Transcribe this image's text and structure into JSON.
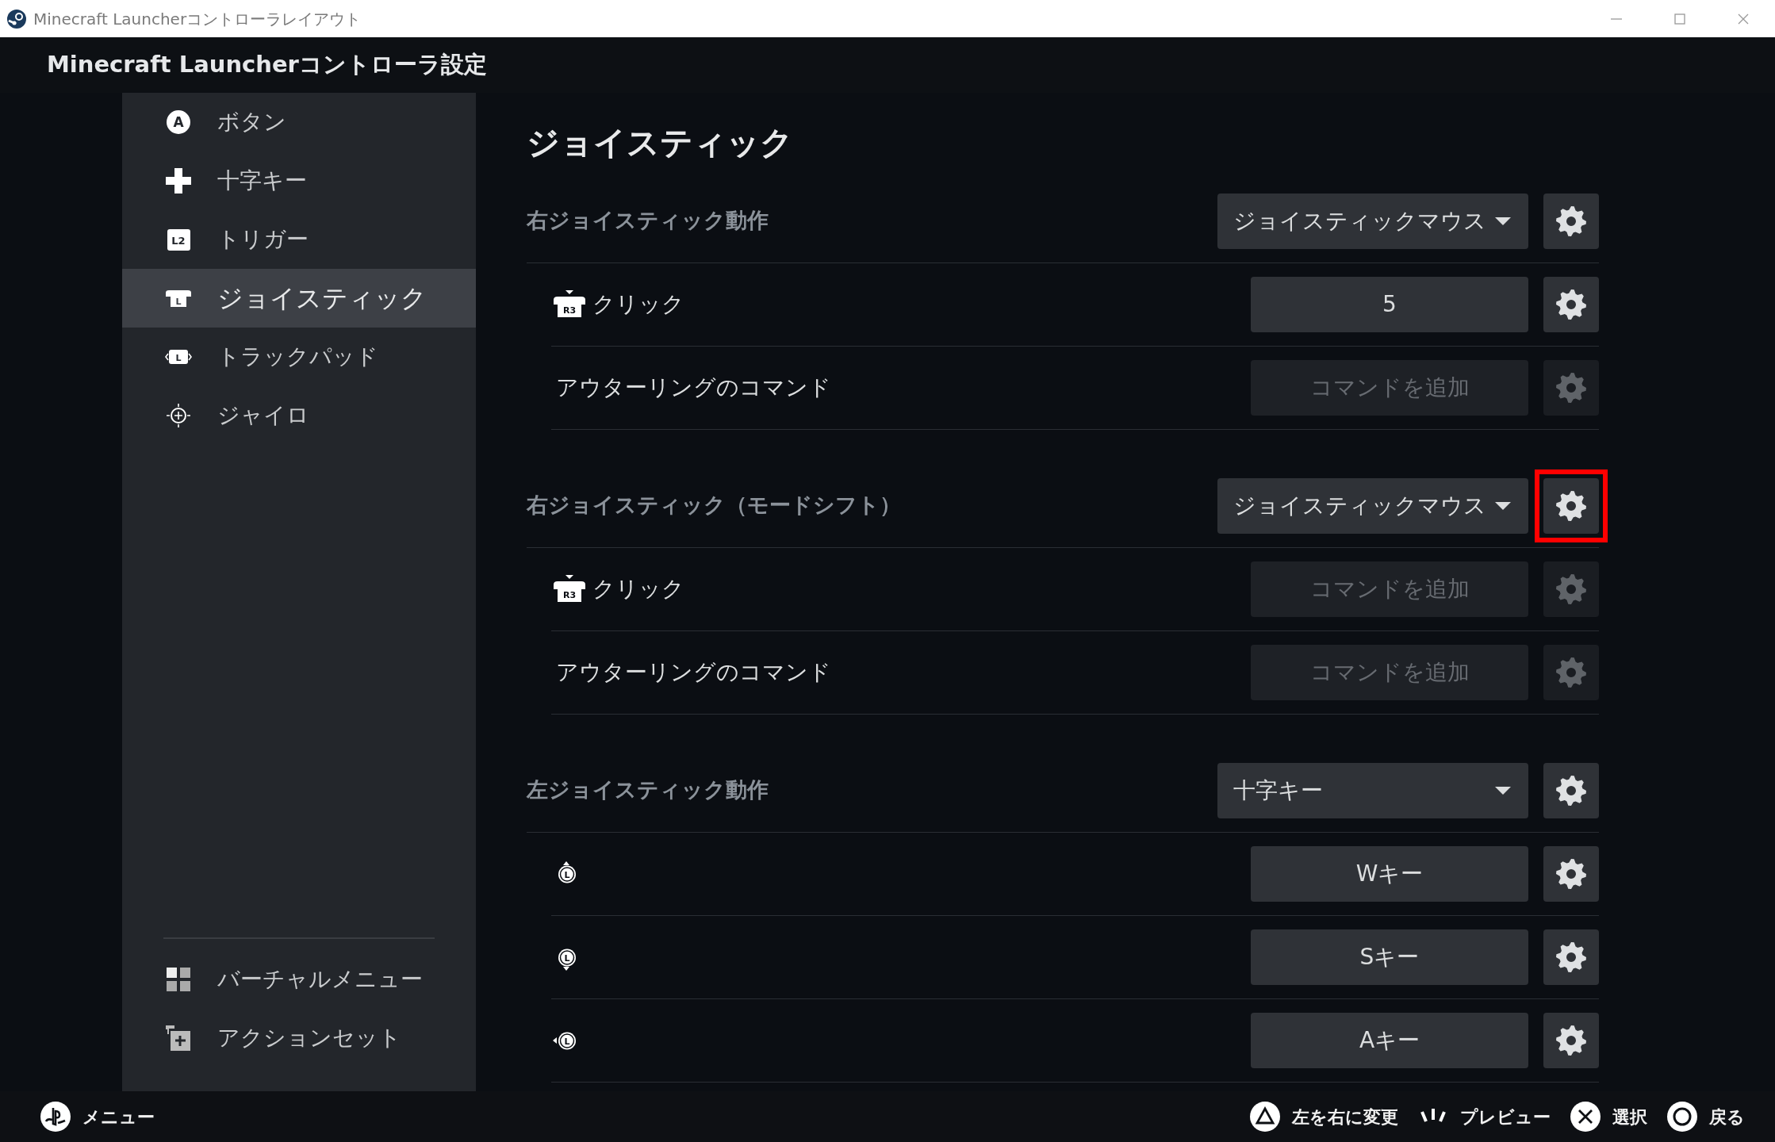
{
  "window": {
    "title": "Minecraft Launcherコントローラレイアウト"
  },
  "header": {
    "title": "Minecraft Launcherコントローラ設定"
  },
  "sidebar": {
    "items": [
      {
        "label": "ボタン",
        "kind": "button",
        "glyph": "A",
        "selected": false
      },
      {
        "label": "十字キー",
        "kind": "dpad",
        "selected": false
      },
      {
        "label": "トリガー",
        "kind": "trigger",
        "glyph": "L2",
        "selected": false
      },
      {
        "label": "ジョイスティック",
        "kind": "joystick",
        "glyph": "L",
        "selected": true
      },
      {
        "label": "トラックパッド",
        "kind": "trackpad",
        "glyph": "L",
        "selected": false
      },
      {
        "label": "ジャイロ",
        "kind": "gyro",
        "selected": false
      }
    ],
    "footer_items": [
      {
        "label": "バーチャルメニュー",
        "kind": "virtual-menu"
      },
      {
        "label": "アクションセット",
        "kind": "action-set"
      }
    ]
  },
  "content": {
    "title": "ジョイスティック",
    "sections": [
      {
        "title": "右ジョイスティック動作",
        "mode": "ジョイスティックマウス",
        "highlighted": false,
        "rows": [
          {
            "kind": "r3",
            "glyph": "R3",
            "label": "クリック",
            "value": "5",
            "disabled": false
          },
          {
            "kind": "text",
            "label": "アウターリングのコマンド",
            "value": "コマンドを追加",
            "disabled": true
          }
        ]
      },
      {
        "title": "右ジョイスティック（モードシフト）",
        "mode": "ジョイスティックマウス",
        "highlighted": true,
        "rows": [
          {
            "kind": "r3",
            "glyph": "R3",
            "label": "クリック",
            "value": "コマンドを追加",
            "disabled": true
          },
          {
            "kind": "text",
            "label": "アウターリングのコマンド",
            "value": "コマンドを追加",
            "disabled": true
          }
        ]
      },
      {
        "title": "左ジョイスティック動作",
        "mode": "十字キー",
        "highlighted": false,
        "rows": [
          {
            "kind": "stick-up",
            "glyph": "L",
            "value": "Wキー",
            "disabled": false
          },
          {
            "kind": "stick-down",
            "glyph": "L",
            "value": "Sキー",
            "disabled": false
          },
          {
            "kind": "stick-left",
            "glyph": "L",
            "value": "Aキー",
            "disabled": false
          }
        ]
      }
    ]
  },
  "footer": {
    "menu": "メニュー",
    "actions": [
      {
        "kind": "triangle",
        "label": "左を右に変更"
      },
      {
        "kind": "preview",
        "label": "プレビュー"
      },
      {
        "kind": "cross",
        "label": "選択"
      },
      {
        "kind": "circle",
        "label": "戻る"
      }
    ]
  }
}
